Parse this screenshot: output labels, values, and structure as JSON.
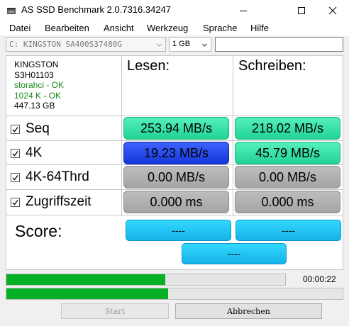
{
  "window": {
    "title": "AS SSD Benchmark 2.0.7316.34247"
  },
  "menu": [
    "Datei",
    "Bearbeiten",
    "Ansicht",
    "Werkzeug",
    "Sprache",
    "Hilfe"
  ],
  "toolbar": {
    "drive": "C: KINGSTON SA400S37480G",
    "size": "1 GB",
    "text_value": ""
  },
  "info": {
    "model": "KINGSTON",
    "firmware": "S3H01103",
    "driver": "storahci - OK",
    "alignment": "1024 K - OK",
    "capacity": "447.13 GB"
  },
  "headers": {
    "read": "Lesen:",
    "write": "Schreiben:"
  },
  "rows": [
    {
      "label": "Seq",
      "read": "253.94 MB/s",
      "write": "218.02 MB/s",
      "checked": true
    },
    {
      "label": "4K",
      "read": "19.23 MB/s",
      "write": "45.79 MB/s",
      "checked": true
    },
    {
      "label": "4K-64Thrd",
      "read": "0.00 MB/s",
      "write": "0.00 MB/s",
      "checked": true
    },
    {
      "label": "Zugriffszeit",
      "read": "0.000 ms",
      "write": "0.000 ms",
      "checked": true
    }
  ],
  "score": {
    "label": "Score:",
    "read": "----",
    "write": "----",
    "total": "----"
  },
  "progress": {
    "bar1_fraction": 0.57,
    "bar2_fraction": 0.48,
    "elapsed": "00:00:22"
  },
  "buttons": {
    "start": "Start",
    "abort": "Abbrechen"
  },
  "colors": {
    "green_pill": "#22d394",
    "blue_pill": "#1536d8",
    "gray_pill": "#a4a4a4",
    "score_pill": "#14b2e8",
    "progress_fill": "#06b025"
  }
}
